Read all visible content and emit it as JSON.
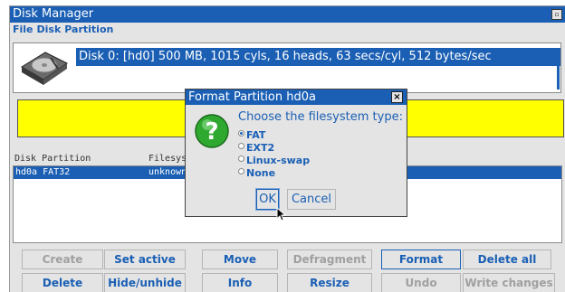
{
  "window": {
    "title": "Disk Manager",
    "title_button": "▫"
  },
  "menu": {
    "items": [
      "File",
      "Disk",
      "Partition"
    ]
  },
  "disk": {
    "selected": "Disk 0: [hd0] 500 MB, 1015 cyls, 16 heads, 63 secs/cyl, 512 bytes/sec"
  },
  "partitions": {
    "headers": {
      "name": "Disk Partition",
      "fs": "Filesys"
    },
    "rows": [
      {
        "name": "hd0a FAT32",
        "fs": "unknown"
      }
    ]
  },
  "buttons": {
    "row1": [
      {
        "label": "Create",
        "enabled": false
      },
      {
        "label": "Set active",
        "enabled": true
      },
      {
        "label": "Move",
        "enabled": true
      },
      {
        "label": "Defragment",
        "enabled": false
      },
      {
        "label": "Format",
        "enabled": true
      },
      {
        "label": "Delete all",
        "enabled": true
      }
    ],
    "row2": [
      {
        "label": "Delete",
        "enabled": true
      },
      {
        "label": "Hide/unhide",
        "enabled": true
      },
      {
        "label": "Info",
        "enabled": true
      },
      {
        "label": "Resize",
        "enabled": true
      },
      {
        "label": "Undo",
        "enabled": false
      },
      {
        "label": "Write changes",
        "enabled": false
      }
    ]
  },
  "dialog": {
    "title": "Format Partition hd0a",
    "close": "×",
    "prompt": "Choose the filesystem type:",
    "options": [
      {
        "label": "FAT",
        "selected": true
      },
      {
        "label": "EXT2",
        "selected": false
      },
      {
        "label": "Linux-swap",
        "selected": false
      },
      {
        "label": "None",
        "selected": false
      }
    ],
    "ok": "OK",
    "cancel": "Cancel"
  },
  "colors": {
    "accent": "#1a5fb4",
    "highlight": "#ffff00",
    "panel": "#e4e4e4"
  }
}
